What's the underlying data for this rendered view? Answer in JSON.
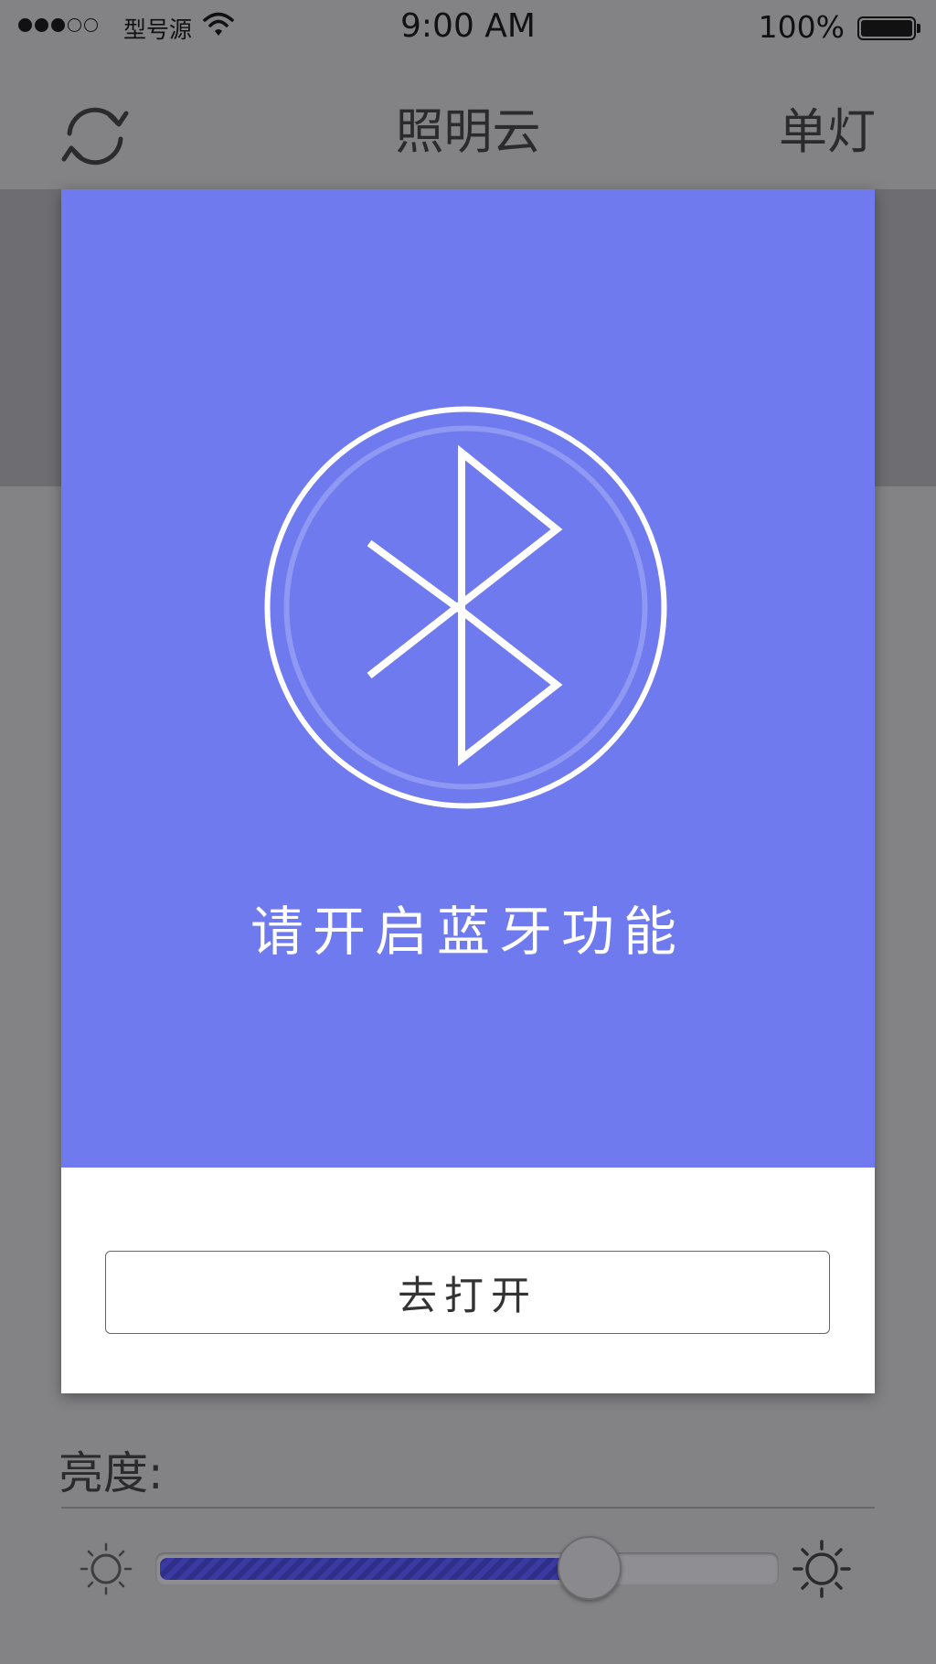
{
  "status_bar": {
    "signal_filled": 3,
    "signal_total": 5,
    "carrier": "型号源",
    "time": "9:00 AM",
    "battery_percent": "100%"
  },
  "nav": {
    "title": "照明云",
    "right_label": "单灯",
    "left_icon": "refresh-icon"
  },
  "modal": {
    "icon": "bluetooth-icon",
    "message": "请开启蓝牙功能",
    "button_label": "去打开",
    "accent_color": "#6e7aed"
  },
  "brightness": {
    "label": "亮度:",
    "value": 0.7,
    "min_icon": "sun-small-icon",
    "max_icon": "sun-large-icon"
  }
}
